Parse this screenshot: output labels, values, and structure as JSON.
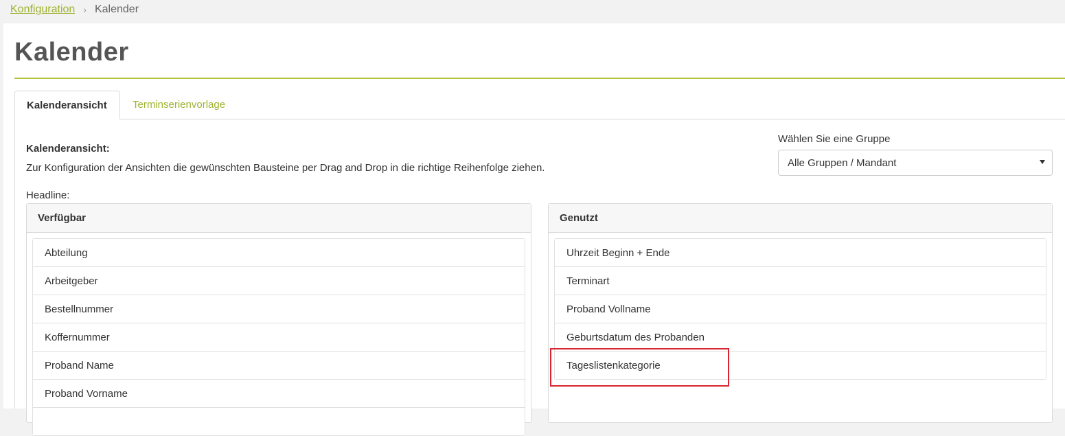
{
  "breadcrumb": {
    "parent": "Konfiguration",
    "separator": "›",
    "current": "Kalender"
  },
  "page": {
    "title": "Kalender"
  },
  "tabs": [
    {
      "label": "Kalenderansicht",
      "active": true
    },
    {
      "label": "Terminserienvorlage",
      "active": false
    }
  ],
  "section": {
    "heading": "Kalenderansicht:",
    "description": "Zur Konfiguration der Ansichten die gewünschten Bausteine per Drag and Drop in die richtige Reihenfolge ziehen.",
    "headline_label": "Headline:"
  },
  "group": {
    "label": "Wählen Sie eine Gruppe",
    "selected": "Alle Gruppen / Mandant"
  },
  "available": {
    "title": "Verfügbar",
    "items": [
      "Abteilung",
      "Arbeitgeber",
      "Bestellnummer",
      "Koffernummer",
      "Proband Name",
      "Proband Vorname",
      ""
    ]
  },
  "used": {
    "title": "Genutzt",
    "items": [
      "Uhrzeit Beginn + Ende",
      "Terminart",
      "Proband Vollname",
      "Geburtsdatum des Probanden",
      "Tageslistenkategorie"
    ]
  },
  "colors": {
    "accent": "#9fb22e",
    "rule": "#b5c23d",
    "highlight": "#d9252f"
  }
}
